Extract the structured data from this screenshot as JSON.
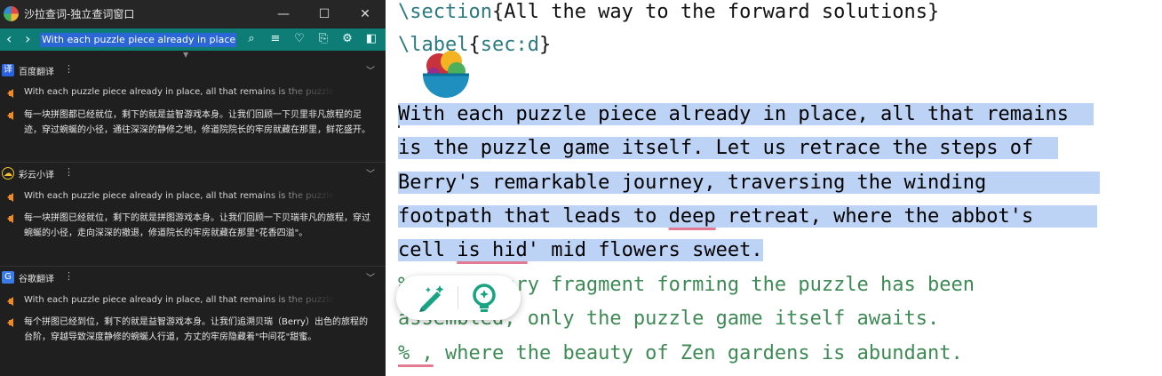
{
  "window": {
    "title": "沙拉查词-独立查词窗口",
    "controls": {
      "minimize": "—",
      "maximize": "☐",
      "close": "✕"
    }
  },
  "search": {
    "query": "With each puzzle piece already in place, all that remains is the puzzle game itself.",
    "icons": [
      "back-icon",
      "forward-icon",
      "search-icon",
      "menu-icon",
      "favorite-icon",
      "history-icon",
      "settings-icon",
      "pin-icon"
    ]
  },
  "dicts": [
    {
      "name": "百度翻译",
      "badge": "译",
      "badge_color": "#2a63e2",
      "more": "⋮",
      "toggle": "﹀",
      "source": "With each puzzle piece already in place, all that remains is the puzzle game itself.",
      "translation": "每一块拼图都已经就位，剩下的就是益智游戏本身。让我们回顾一下贝里非凡旅程的足迹，穿过蜿蜒的小径，通往深深的静修之地，修道院院长的牢房就藏在那里，鲜花盛开。"
    },
    {
      "name": "彩云小译",
      "badge": "☁",
      "badge_color": "#f2c030",
      "more": "⋮",
      "toggle": "﹀",
      "source": "With each puzzle piece already in place, all that remains is the puzzle game itself.",
      "translation": "每一块拼图已经就位，剩下的就是拼图游戏本身。让我们回顾一下贝瑞非凡的旅程，穿过蜿蜒的小径，走向深深的撤退，修道院长的牢房就藏在那里\"花香四溢\"。"
    },
    {
      "name": "谷歌翻译",
      "badge": "G",
      "badge_color": "#3a7be8",
      "more": "⋮",
      "toggle": "﹀",
      "source": "With each puzzle piece already in place, all that remains is the puzzle game itself.",
      "translation": "每个拼图已经到位，剩下的就是益智游戏本身。让我们追溯贝瑞（Berry）出色的旅程的台阶，穿越导致深度静修的蜿蜒人行道，方丈的牢房隐藏着\"中间花\"甜蜜。"
    }
  ],
  "editor": {
    "line1": {
      "cmd": "\\section",
      "open": "{",
      "arg": "All the way to the forward solutions",
      "close": "}"
    },
    "line2": {
      "cmd": "\\label",
      "open": "{",
      "arg": "sec:d",
      "close": "}"
    },
    "selected": [
      "With each puzzle piece already in place, all that remains",
      "is the puzzle game itself. Let us retrace the steps of",
      "Berry's remarkable journey, traversing the winding",
      "footpath that leads to ",
      "deep",
      " retreat, where the abbot's",
      "cell ",
      "is hid",
      "' mid flowers sweet."
    ],
    "comments": [
      "%    t every fragment forming the puzzle has been",
      "assembled, only the puzzle game itself awaits.",
      "% ,",
      " where the beauty of Zen gardens is abundant."
    ]
  }
}
